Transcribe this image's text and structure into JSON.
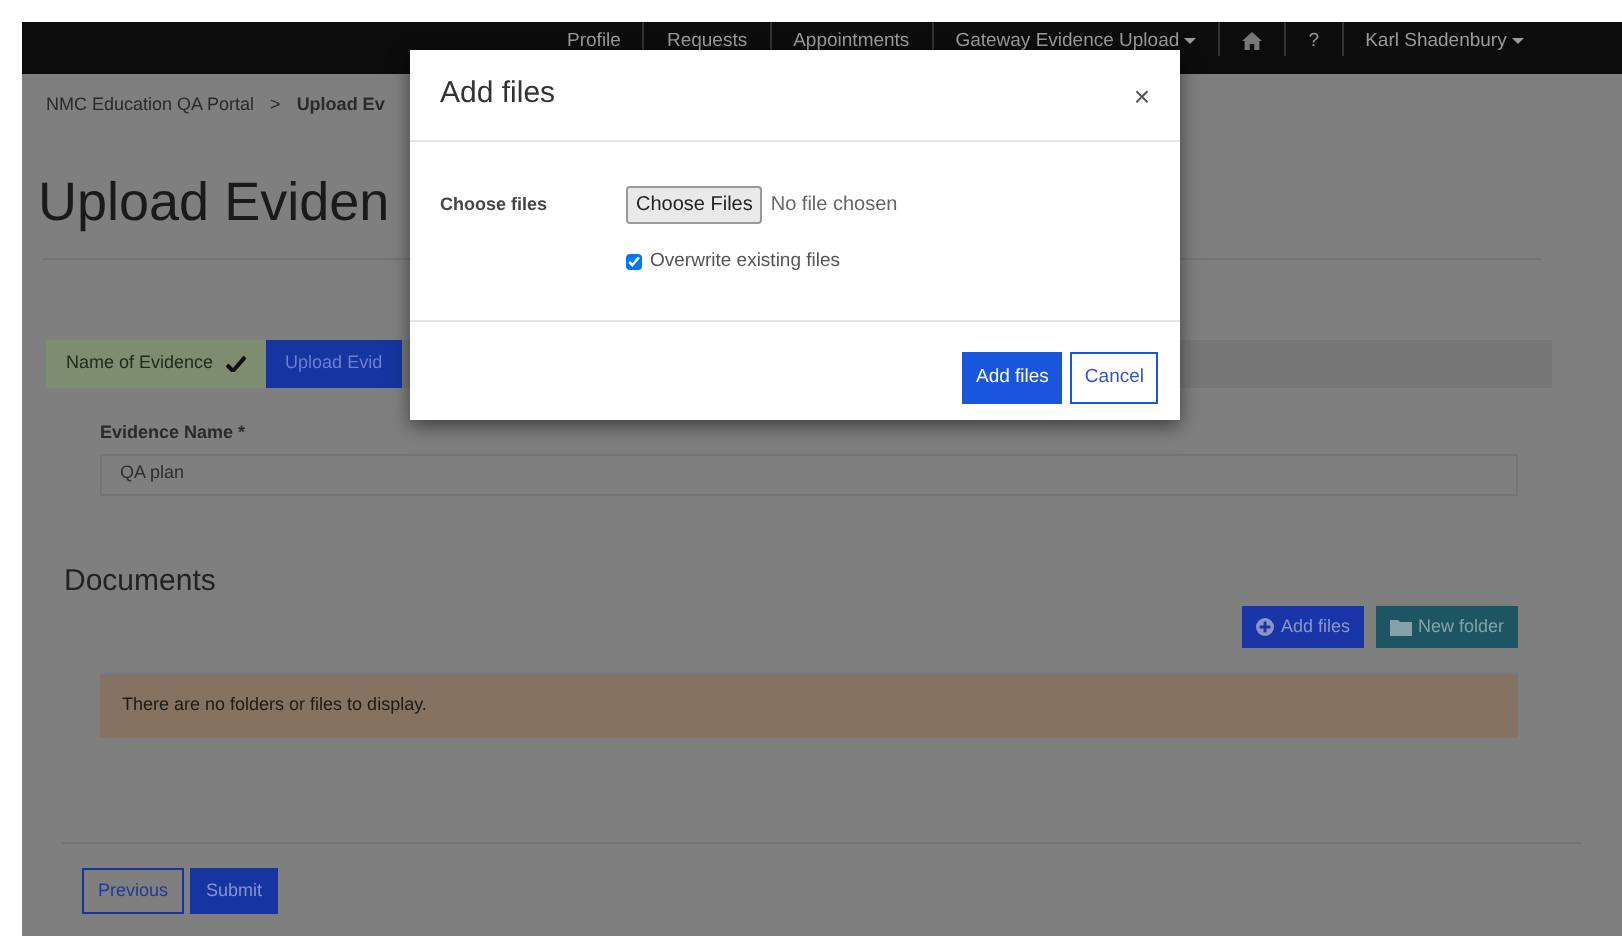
{
  "navbar": {
    "items": [
      {
        "label": "Profile",
        "kind": "link"
      },
      {
        "label": "Requests",
        "kind": "link"
      },
      {
        "label": "Appointments",
        "kind": "link"
      },
      {
        "label": "Gateway Evidence Upload",
        "kind": "dropdown"
      },
      {
        "kind": "home"
      },
      {
        "label": "?",
        "kind": "link"
      },
      {
        "label": "Karl Shadenbury",
        "kind": "dropdown"
      }
    ]
  },
  "breadcrumb": {
    "root": "NMC Education QA Portal",
    "separator": ">",
    "current": "Upload Ev"
  },
  "page_title": "Upload Eviden",
  "steps": [
    {
      "label": "Name of Evidence",
      "kind": "done"
    },
    {
      "label": "Upload Evid",
      "kind": "current"
    }
  ],
  "evidence_name": {
    "label": "Evidence Name",
    "required_mark": "*",
    "value": "QA plan"
  },
  "documents": {
    "title": "Documents",
    "buttons": [
      {
        "label": "Add files",
        "kind": "add"
      },
      {
        "label": "New folder",
        "kind": "folder"
      }
    ],
    "empty_message": "There are no folders or files to display."
  },
  "footer_buttons": [
    {
      "label": "Previous",
      "kind": "outline"
    },
    {
      "label": "Submit",
      "kind": "primary"
    }
  ],
  "modal": {
    "title": "Add files",
    "close": "×",
    "field_label": "Choose files",
    "file_button": "Choose Files",
    "file_status": "No file chosen",
    "overwrite": {
      "label": "Overwrite existing files",
      "checked": true
    },
    "buttons": [
      {
        "label": "Add files",
        "kind": "primary"
      },
      {
        "label": "Cancel",
        "kind": "outline"
      }
    ]
  }
}
